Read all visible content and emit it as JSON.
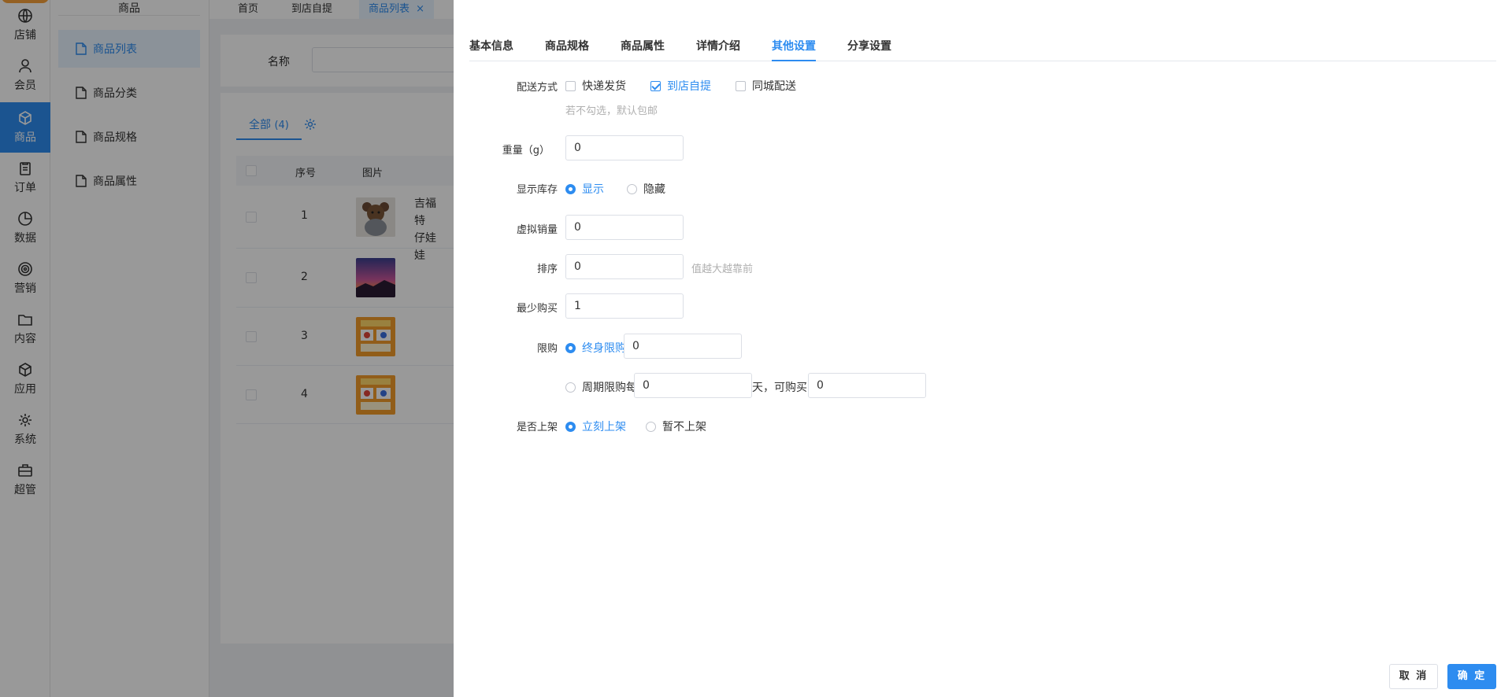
{
  "rail": {
    "items": [
      {
        "label": "店铺",
        "icon": "store-icon"
      },
      {
        "label": "会员",
        "icon": "user-icon"
      },
      {
        "label": "商品",
        "icon": "box-icon"
      },
      {
        "label": "订单",
        "icon": "clipboard-icon"
      },
      {
        "label": "数据",
        "icon": "pie-chart-icon"
      },
      {
        "label": "营销",
        "icon": "target-icon"
      },
      {
        "label": "内容",
        "icon": "folder-icon"
      },
      {
        "label": "应用",
        "icon": "cube-icon"
      },
      {
        "label": "系统",
        "icon": "gear-icon"
      },
      {
        "label": "超管",
        "icon": "briefcase-icon"
      }
    ],
    "active_index": 2
  },
  "submenu": {
    "title": "商品",
    "items": [
      "商品列表",
      "商品分类",
      "商品规格",
      "商品属性"
    ],
    "active_index": 0
  },
  "tabbar": {
    "tabs": [
      "首页",
      "到店自提",
      "商品列表"
    ],
    "close_glyph": "×"
  },
  "search": {
    "name_label": "名称"
  },
  "table": {
    "category_tab": "全部",
    "category_count": "(4)",
    "headers": {
      "index": "序号",
      "image": "图片"
    },
    "rows": [
      {
        "index": "1",
        "name": "吉福特\n仔娃娃"
      },
      {
        "index": "2",
        "name": ""
      },
      {
        "index": "3",
        "name": ""
      },
      {
        "index": "4",
        "name": ""
      }
    ]
  },
  "drawer": {
    "tabs": [
      "基本信息",
      "商品规格",
      "商品属性",
      "详情介绍",
      "其他设置",
      "分享设置"
    ],
    "active_tab": 4,
    "form": {
      "delivery": {
        "label": "配送方式",
        "options": [
          {
            "label": "快递发货",
            "checked": false
          },
          {
            "label": "到店自提",
            "checked": true
          },
          {
            "label": "同城配送",
            "checked": false
          }
        ],
        "hint": "若不勾选，默认包邮"
      },
      "weight": {
        "label": "重量（g）",
        "value": "0"
      },
      "show_stock": {
        "label": "显示库存",
        "options": [
          {
            "label": "显示",
            "selected": true
          },
          {
            "label": "隐藏",
            "selected": false
          }
        ]
      },
      "virtual_sales": {
        "label": "虚拟销量",
        "value": "0"
      },
      "sort": {
        "label": "排序",
        "value": "0",
        "hint": "值越大越靠前"
      },
      "min_buy": {
        "label": "最少购买",
        "value": "1"
      },
      "limit": {
        "label": "限购",
        "lifetime_label": "终身限购",
        "lifetime_selected": true,
        "lifetime_value": "0",
        "period_label": "周期限购每",
        "period_selected": false,
        "period_value": "0",
        "period_unit": "天，可购买",
        "period_qty": "0"
      },
      "on_shelf": {
        "label": "是否上架",
        "options": [
          {
            "label": "立刻上架",
            "selected": true
          },
          {
            "label": "暂不上架",
            "selected": false
          }
        ]
      }
    },
    "footer": {
      "cancel_label": "取 消",
      "ok_label": "确 定"
    }
  },
  "colors": {
    "accent": "#2d8cf0",
    "overlay": "rgba(0,0,0,0.4)"
  }
}
